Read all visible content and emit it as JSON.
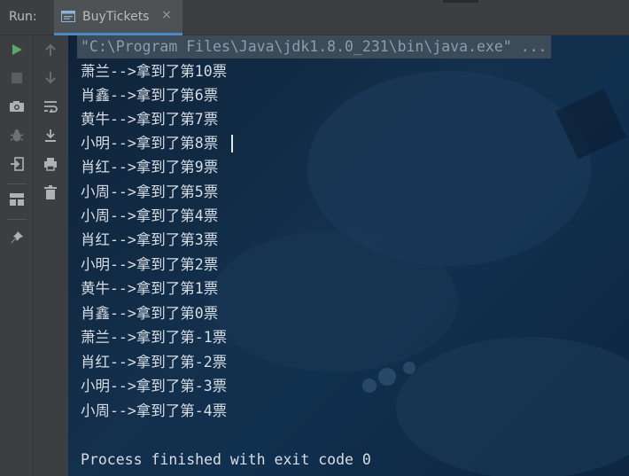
{
  "run_bar": {
    "label": "Run:",
    "tab_title": "BuyTickets",
    "tab_close": "×"
  },
  "toolbar_left": [
    "run-icon",
    "stop-icon",
    "camera-icon",
    "debug-icon",
    "exit-icon",
    "layout-icon",
    "pin-icon"
  ],
  "toolbar_right": [
    "up-arrow-icon",
    "down-arrow-icon",
    "soft-wrap-icon",
    "scroll-to-end-icon",
    "print-icon",
    "trash-icon"
  ],
  "console": {
    "command": "\"C:\\Program Files\\Java\\jdk1.8.0_231\\bin\\java.exe\" ...",
    "lines": [
      "萧兰-->拿到了第10票",
      "肖鑫-->拿到了第6票",
      "黄牛-->拿到了第7票",
      "小明-->拿到了第8票",
      "肖红-->拿到了第9票",
      "小周-->拿到了第5票",
      "小周-->拿到了第4票",
      "肖红-->拿到了第3票",
      "小明-->拿到了第2票",
      "黄牛-->拿到了第1票",
      "肖鑫-->拿到了第0票",
      "萧兰-->拿到了第-1票",
      "肖红-->拿到了第-2票",
      "小明-->拿到了第-3票",
      "小周-->拿到了第-4票"
    ],
    "finish": "Process finished with exit code 0"
  },
  "colors": {
    "panel": "#3c3f41",
    "console_bg": "#13304d",
    "text": "#d8dde4",
    "command_text": "#8c9db0",
    "run_green": "#59a869",
    "tab_accent": "#4a88c7"
  }
}
